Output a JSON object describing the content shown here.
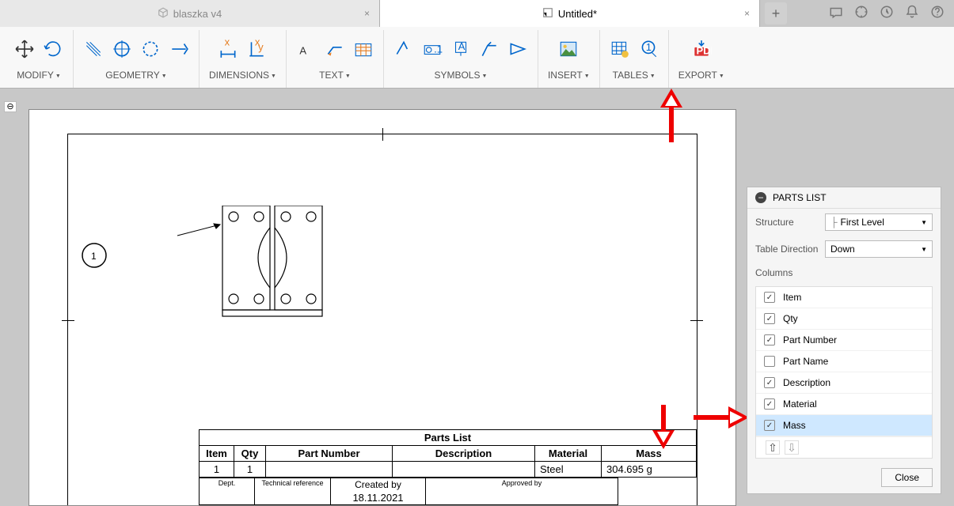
{
  "tabs": {
    "inactive_title": "blaszka v4",
    "active_title": "Untitled*"
  },
  "ribbon": {
    "modify": "MODIFY",
    "geometry": "GEOMETRY",
    "dimensions": "DIMENSIONS",
    "text": "TEXT",
    "symbols": "SYMBOLS",
    "insert": "INSERT",
    "tables": "TABLES",
    "export": "EXPORT"
  },
  "drawing": {
    "balloon_number": "1"
  },
  "parts_list_table": {
    "title": "Parts List",
    "headers": [
      "Item",
      "Qty",
      "Part Number",
      "Description",
      "Material",
      "Mass"
    ],
    "row": [
      "1",
      "1",
      "",
      "",
      "Steel",
      "304.695 g"
    ]
  },
  "title_block": {
    "dept": "Dept.",
    "tech_ref": "Technical reference",
    "created_by": "Created by",
    "approved_by": "Approved by",
    "date": "18.11.2021"
  },
  "panel": {
    "title": "PARTS LIST",
    "structure_label": "Structure",
    "structure_value": "First Level",
    "direction_label": "Table Direction",
    "direction_value": "Down",
    "columns_label": "Columns",
    "columns": [
      {
        "name": "Item",
        "checked": true,
        "selected": false
      },
      {
        "name": "Qty",
        "checked": true,
        "selected": false
      },
      {
        "name": "Part Number",
        "checked": true,
        "selected": false
      },
      {
        "name": "Part Name",
        "checked": false,
        "selected": false
      },
      {
        "name": "Description",
        "checked": true,
        "selected": false
      },
      {
        "name": "Material",
        "checked": true,
        "selected": false
      },
      {
        "name": "Mass",
        "checked": true,
        "selected": true
      }
    ],
    "close": "Close"
  }
}
